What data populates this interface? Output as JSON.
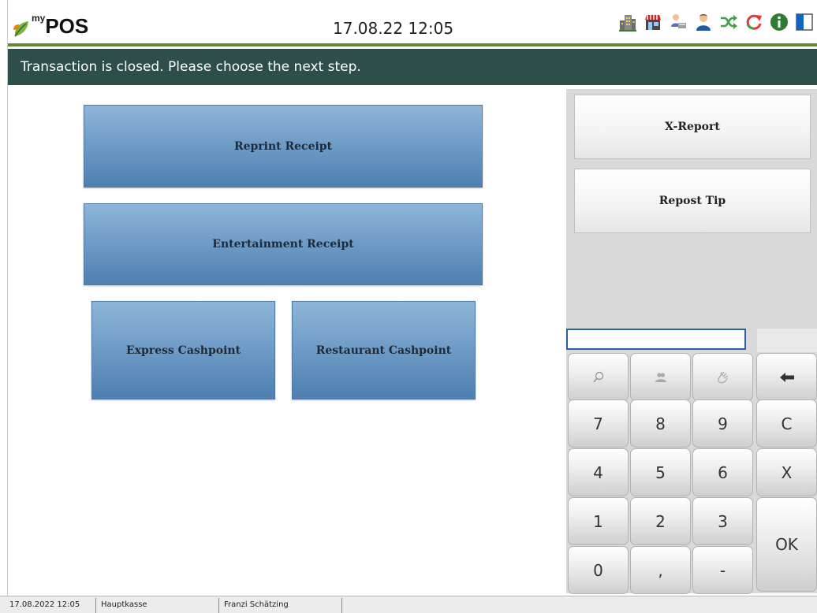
{
  "header": {
    "logo_my": "my",
    "logo_pos": "POS",
    "datetime": "17.08.22  12:05",
    "icons": [
      "building-icon",
      "shop-icon",
      "cashier-icon",
      "user-icon",
      "shuffle-icon",
      "refresh-icon",
      "info-icon",
      "panel-icon"
    ]
  },
  "message": "Transaction is closed. Please choose the next step.",
  "actions": {
    "reprint_receipt": "Reprint Receipt",
    "entertainment_receipt": "Entertainment Receipt",
    "express_cashpoint": "Express Cashpoint",
    "restaurant_cashpoint": "Restaurant Cashpoint"
  },
  "side": {
    "x_report": "X-Report",
    "repost_tip": "Repost Tip"
  },
  "keypad": {
    "input_value": "",
    "keys": {
      "seven": "7",
      "eight": "8",
      "nine": "9",
      "clear": "C",
      "four": "4",
      "five": "5",
      "six": "6",
      "cancel": "X",
      "one": "1",
      "two": "2",
      "three": "3",
      "ok": "OK",
      "zero": "0",
      "comma": ",",
      "minus": "-"
    }
  },
  "status": {
    "datetime": "17.08.2022 12:05",
    "register": "Hauptkasse",
    "user": "Franzi Schätzing"
  },
  "colors": {
    "message_bar": "#2e4e4a",
    "header_rule": "#5f8a2e",
    "blue_button": "#6a98c4",
    "input_border": "#2b5fa8"
  }
}
